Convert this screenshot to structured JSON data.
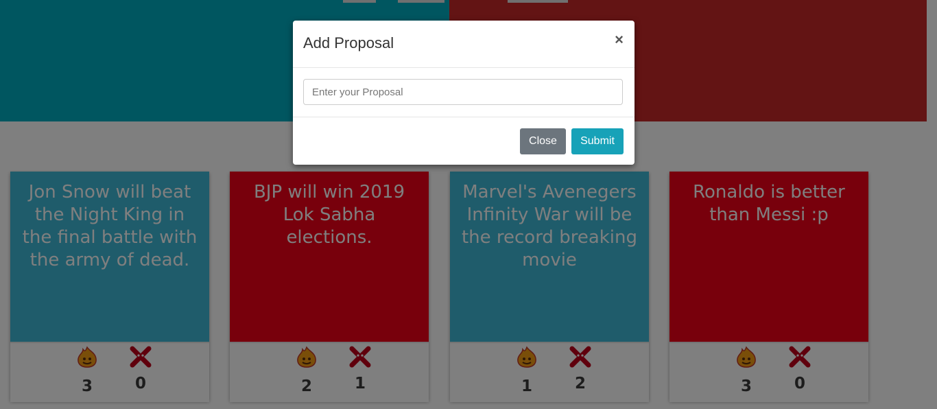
{
  "modal": {
    "title": "Add Proposal",
    "close_icon": "×",
    "input_placeholder": "Enter your Proposal",
    "close_label": "Close",
    "submit_label": "Submit"
  },
  "cards": [
    {
      "text": "Jon Snow will beat the Night King in the final battle with the army of dead.",
      "theme": "blue",
      "fire_count": "3",
      "nope_count": "0"
    },
    {
      "text": "BJP will win 2019 Lok Sabha elections.",
      "theme": "red",
      "fire_count": "2",
      "nope_count": "1"
    },
    {
      "text": "Marvel's Avenegers Infinity War will be the record breaking movie",
      "theme": "blue",
      "fire_count": "1",
      "nope_count": "2"
    },
    {
      "text": "Ronaldo is better than Messi :p",
      "theme": "red",
      "fire_count": "3",
      "nope_count": "0"
    }
  ],
  "icons": {
    "fire": "fire-icon",
    "nope": "red-cross-icon"
  },
  "colors": {
    "blue_card": "#3fb8d6",
    "red_card": "#f00018",
    "hero_left": "#00acc1",
    "hero_right": "#c62828",
    "submit": "#17a2b8",
    "close": "#6c757d"
  }
}
